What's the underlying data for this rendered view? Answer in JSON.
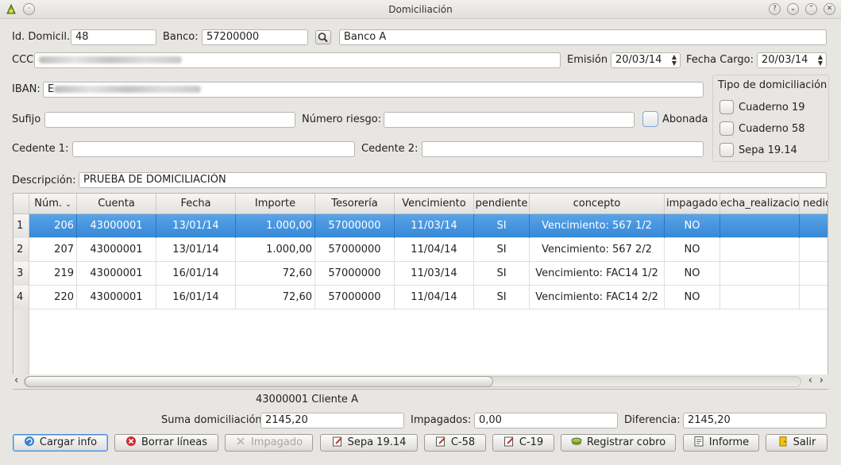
{
  "window": {
    "title": "Domiciliación",
    "controls": [
      "?",
      "⌄",
      "⌃",
      "✕"
    ]
  },
  "form": {
    "id_domicil_label": "Id. Domicil.",
    "id_domicil_value": "48",
    "banco_label": "Banco:",
    "banco_code": "57200000",
    "banco_name": "Banco A",
    "ccc_label": "CCC",
    "emision_label": "Emisión",
    "emision_value": "20/03/14",
    "fecha_cargo_label": "Fecha Cargo:",
    "fecha_cargo_value": "20/03/14",
    "iban_label": "IBAN:",
    "iban_prefix": "E",
    "sufijo_label": "Sufijo",
    "numero_riesgo_label": "Número riesgo:",
    "abonada_label": "Abonada",
    "cedente1_label": "Cedente 1:",
    "cedente2_label": "Cedente 2:",
    "descripcion_label": "Descripción:",
    "descripcion_value": "PRUEBA DE DOMICILIACIÓN"
  },
  "tipo": {
    "title": "Tipo de domiciliación",
    "options": [
      "Cuaderno 19",
      "Cuaderno 58",
      "Sepa 19.14"
    ]
  },
  "table": {
    "columns": [
      "Núm.",
      "Cuenta",
      "Fecha",
      "Importe",
      "Tesorería",
      "Vencimiento",
      "pendiente",
      "concepto",
      "impagado",
      "echa_realizacio",
      "nedio_"
    ],
    "rows": [
      {
        "n": "1",
        "num": "206",
        "cuenta": "43000001",
        "fecha": "13/01/14",
        "importe": "1.000,00",
        "tesoreria": "57000000",
        "vencimiento": "11/03/14",
        "pendiente": "SI",
        "concepto": "Vencimiento: 567 1/2",
        "impagado": "NO"
      },
      {
        "n": "2",
        "num": "207",
        "cuenta": "43000001",
        "fecha": "13/01/14",
        "importe": "1.000,00",
        "tesoreria": "57000000",
        "vencimiento": "11/04/14",
        "pendiente": "SI",
        "concepto": "Vencimiento: 567 2/2",
        "impagado": "NO"
      },
      {
        "n": "3",
        "num": "219",
        "cuenta": "43000001",
        "fecha": "16/01/14",
        "importe": "72,60",
        "tesoreria": "57000000",
        "vencimiento": "11/03/14",
        "pendiente": "SI",
        "concepto": "Vencimiento: FAC14 1/2",
        "impagado": "NO"
      },
      {
        "n": "4",
        "num": "220",
        "cuenta": "43000001",
        "fecha": "16/01/14",
        "importe": "72,60",
        "tesoreria": "57000000",
        "vencimiento": "11/04/14",
        "pendiente": "SI",
        "concepto": "Vencimiento: FAC14 2/2",
        "impagado": "NO"
      }
    ]
  },
  "footer": {
    "client": "43000001 Cliente A",
    "suma_label": "Suma domiciliación",
    "suma_value": "2145,20",
    "impagados_label": "Impagados:",
    "impagados_value": "0,00",
    "diferencia_label": "Diferencia:",
    "diferencia_value": "2145,20"
  },
  "buttons": {
    "cargar": "Cargar info",
    "borrar": "Borrar líneas",
    "impagado": "Impagado",
    "sepa": "Sepa 19.14",
    "c58": "C-58",
    "c19": "C-19",
    "registrar": "Registrar cobro",
    "informe": "Informe",
    "salir": "Salir"
  },
  "icons": {
    "app": "app-logo-icon",
    "search": "search-icon",
    "cargar": "reload-icon",
    "borrar": "delete-icon",
    "impagado": "cancel-icon",
    "edit": "edit-document-icon",
    "registrar": "money-icon",
    "informe": "report-icon",
    "salir": "exit-door-icon"
  },
  "colors": {
    "selection": "#3688d8",
    "window": "#e8e6e3"
  }
}
